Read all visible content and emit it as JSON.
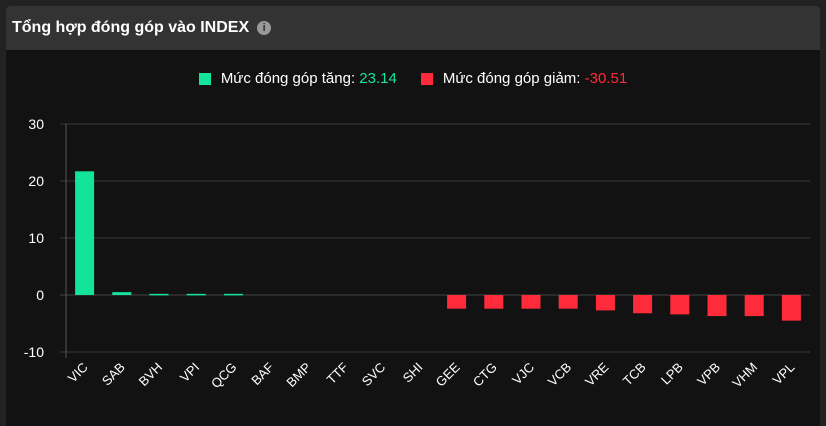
{
  "header": {
    "title": "Tổng hợp đóng góp vào INDEX",
    "info_icon": "i"
  },
  "legend": {
    "up_label": "Mức đóng góp tăng:",
    "up_value": "23.14",
    "down_label": "Mức đóng góp giảm:",
    "down_value": "-30.51"
  },
  "colors": {
    "up": "#12e59a",
    "down": "#ff2b3a",
    "grid": "#3a3a3a"
  },
  "chart_data": {
    "type": "bar",
    "title": "Tổng hợp đóng góp vào INDEX",
    "categories": [
      "VIC",
      "SAB",
      "BVH",
      "VPI",
      "QCG",
      "BAF",
      "BMP",
      "TTF",
      "SVC",
      "SHI",
      "GEE",
      "CTG",
      "VJC",
      "VCB",
      "VRE",
      "TCB",
      "LPB",
      "VPB",
      "VHM",
      "VPL"
    ],
    "values": [
      21.7,
      0.5,
      0.2,
      0.2,
      0.2,
      0,
      0,
      0,
      0,
      0,
      -2.4,
      -2.4,
      -2.4,
      -2.4,
      -2.7,
      -3.2,
      -3.4,
      -3.7,
      -3.7,
      -4.5
    ],
    "yticks": [
      "30",
      "20",
      "10",
      "0",
      "-10"
    ],
    "ylim": [
      -10,
      30
    ],
    "grid": true,
    "legend_position": "top-center"
  }
}
